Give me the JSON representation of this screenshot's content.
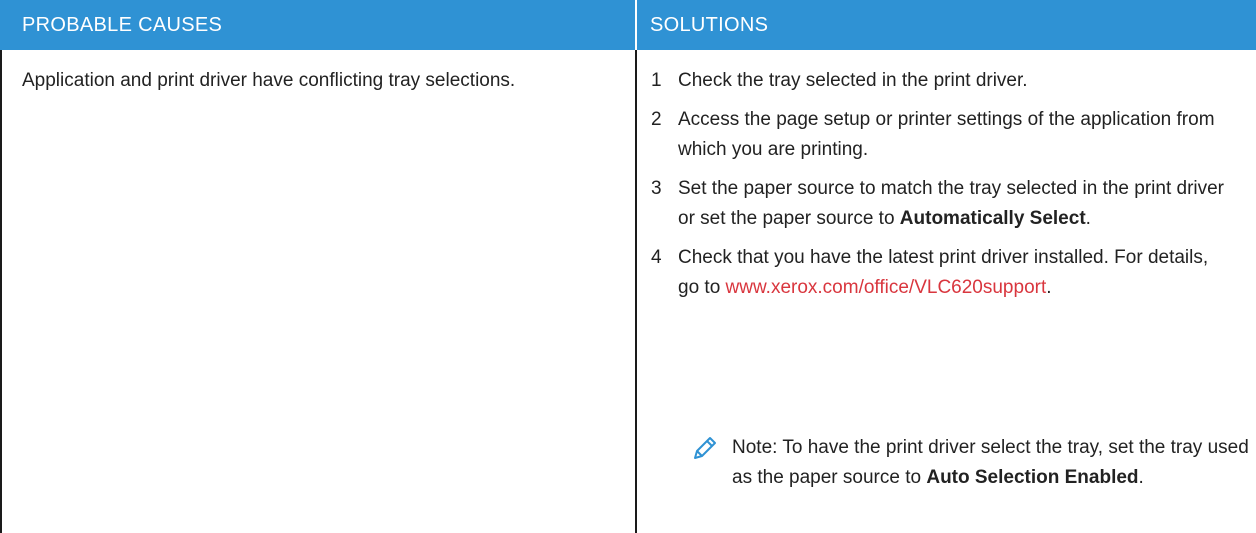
{
  "header": {
    "left_label": "PROBABLE CAUSES",
    "right_label": "SOLUTIONS"
  },
  "cause": "Application and print driver have conflicting tray selections.",
  "steps": [
    {
      "num": "1",
      "text": "Check the tray selected in the print driver."
    },
    {
      "num": "2",
      "text": "Access the page setup or printer settings of the application from which you are printing."
    },
    {
      "num": "3",
      "text_before": "Set the paper source to match the tray selected in the print driver or set the paper source to ",
      "bold": "Automatically Select",
      "text_after": "."
    },
    {
      "num": "4",
      "text_before": "Check that you have the latest print driver installed. For details, go to ",
      "link": "www.xerox.com/office/VLC620support",
      "text_after": "."
    }
  ],
  "note": {
    "icon": "pencil-note-icon",
    "text_before": "Note: To have the print driver select the tray, set the tray used as the paper source to ",
    "bold": "Auto Selection Enabled",
    "text_after": "."
  },
  "colors": {
    "header_bg": "#2f92d4",
    "link": "#d9363e",
    "icon": "#2f92d4"
  }
}
